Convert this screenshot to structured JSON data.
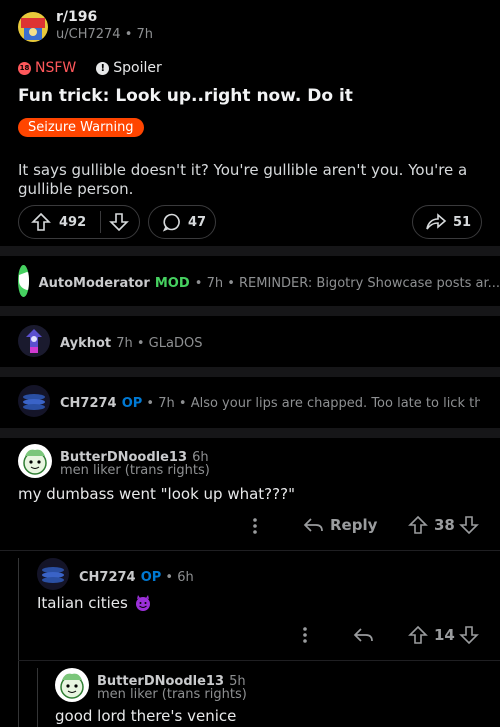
{
  "post": {
    "subreddit": "r/196",
    "author": "u/CH7274",
    "age": "7h",
    "nsfw_label": "NSFW",
    "nsfw_icon_text": "18",
    "spoiler_label": "Spoiler",
    "title": "Fun trick: Look up..right now. Do it",
    "flair": "Seizure Warning",
    "body": "It says gullible doesn't it? You're gullible aren't you. You're a gullible person.",
    "upvotes": "492",
    "comments": "47",
    "shares": "51"
  },
  "collapsed": [
    {
      "user": "AutoModerator",
      "badge": "MOD",
      "age": "7h",
      "text": "REMINDER: Bigotry Showcase posts ar..."
    },
    {
      "user": "Aykhot",
      "age": "7h",
      "text": "GLaDOS"
    },
    {
      "user": "CH7274",
      "badge": "OP",
      "age": "7h",
      "text": "Also your lips are chapped. Too late to lick them...."
    }
  ],
  "comments": [
    {
      "user": "ButterDNoodle13",
      "age": "6h",
      "flair": "men liker (trans rights)",
      "text": "my dumbass went \"look up what???\"",
      "reply_label": "Reply",
      "score": "38"
    },
    {
      "user": "CH7274",
      "badge": "OP",
      "age": "6h",
      "text": "Italian cities",
      "score": "14"
    },
    {
      "user": "ButterDNoodle13",
      "age": "5h",
      "flair": "men liker (trans rights)",
      "text": "good lord there's venice"
    }
  ],
  "colors": {
    "accent": "#ff4500",
    "mod": "#46d160",
    "op": "#0079d3"
  }
}
